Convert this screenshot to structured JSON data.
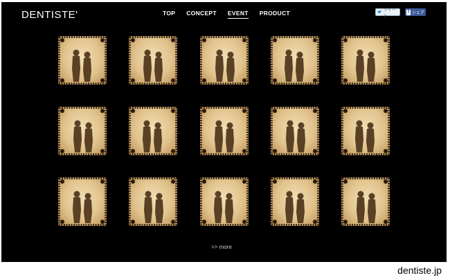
{
  "brand": {
    "logo_text": "DENTISTE'"
  },
  "nav": {
    "items": [
      {
        "label": "TOP",
        "active": false
      },
      {
        "label": "CONCEPT",
        "active": false
      },
      {
        "label": "EVENT",
        "active": true
      },
      {
        "label": "PRODUCT",
        "active": false
      }
    ]
  },
  "social": {
    "tweet_label": "ツイート",
    "share_label": "シェア"
  },
  "gallery": {
    "photo_count": 15,
    "more_label": ">> more"
  },
  "caption": "dentiste.jp",
  "colors": {
    "page_bg": "#000000",
    "frame_light": "#f3dfb4",
    "frame_dark": "#b98d52",
    "silhouette": "#5a4024",
    "facebook": "#3b5998"
  }
}
